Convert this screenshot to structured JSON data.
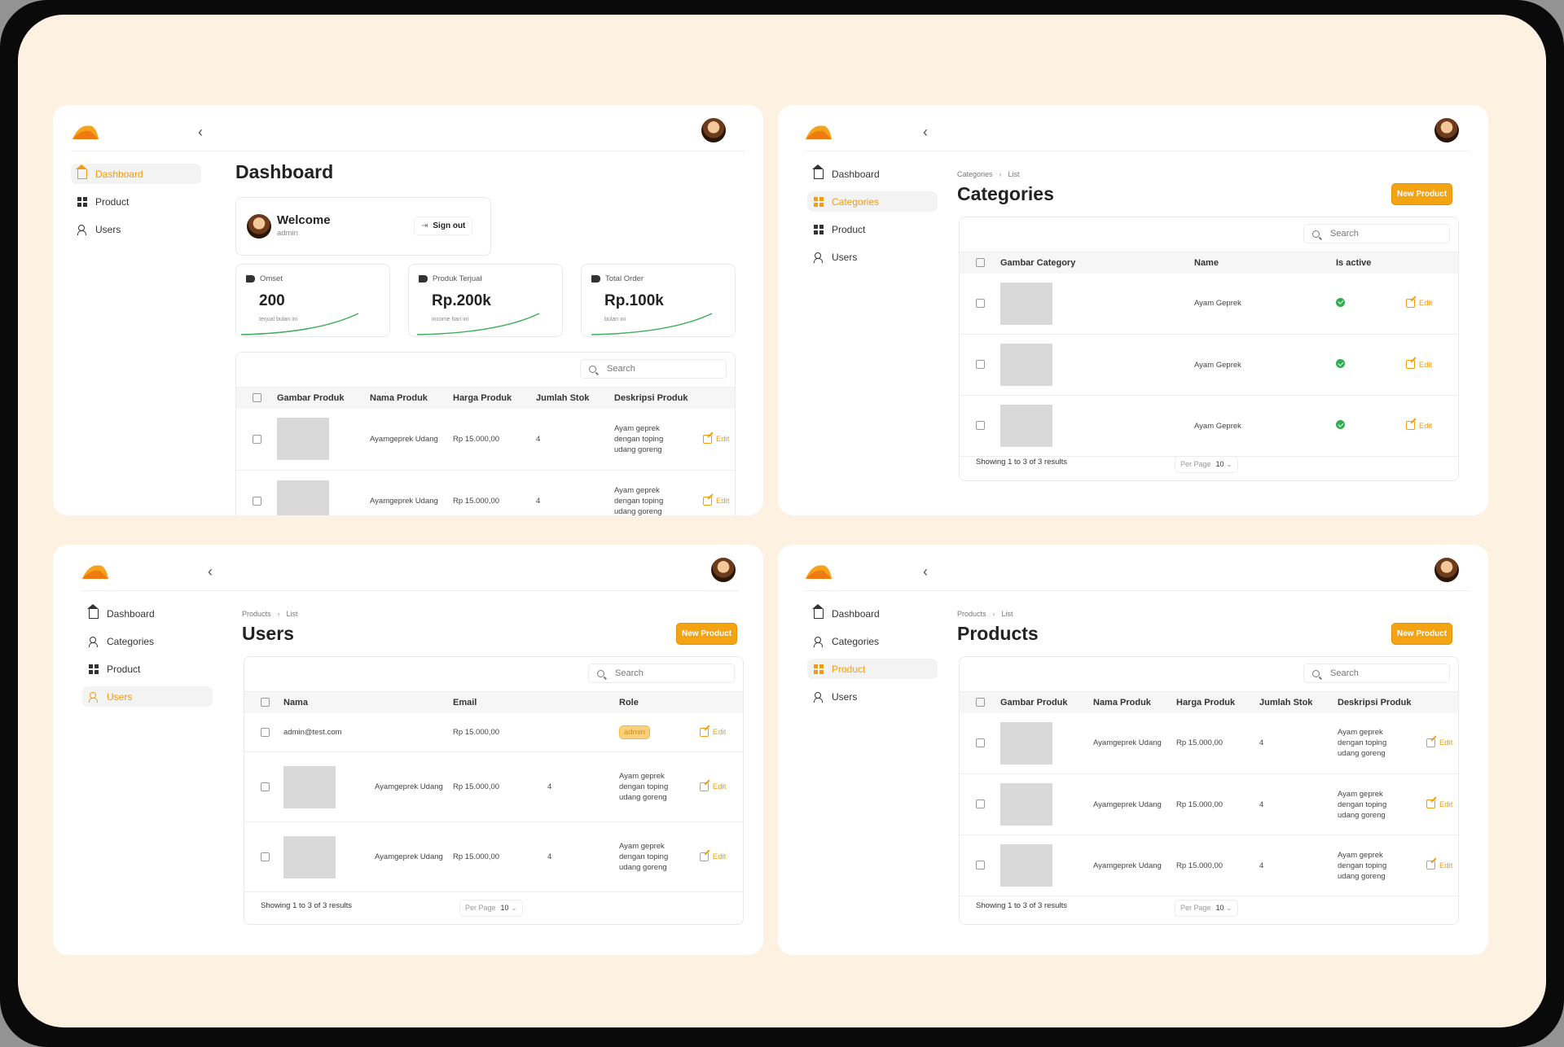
{
  "colors": {
    "accent": "#f29c11",
    "button": "#f4a312",
    "active_check": "#2eae4f",
    "canvas": "#fdf1e2"
  },
  "icons": {
    "logo": "orange-fan-logo",
    "collapse": "chevron-left-icon",
    "avatar": "user-avatar"
  },
  "dashboard": {
    "sidebar": [
      {
        "label": "Dashboard",
        "icon": "home-icon",
        "active": true
      },
      {
        "label": "Product",
        "icon": "grid-icon"
      },
      {
        "label": "Users",
        "icon": "users-icon"
      }
    ],
    "title": "Dashboard",
    "welcome": {
      "title": "Welcome",
      "role": "admin",
      "signout": "Sign out"
    },
    "stats": [
      {
        "label": "Omset",
        "value": "200",
        "sub": "terjual bulan ini",
        "icon": "tag-icon"
      },
      {
        "label": "Produk Terjual",
        "value": "Rp.200k",
        "sub": "income hari ini",
        "icon": "tag-icon"
      },
      {
        "label": "Total Order",
        "value": "Rp.100k",
        "sub": "bulan ini",
        "icon": "tag-icon"
      }
    ],
    "search_placeholder": "Search",
    "columns": [
      "Gambar Produk",
      "Nama Produk",
      "Harga Produk",
      "Jumlah Stok",
      "Deskripsi Produk"
    ],
    "rows": [
      {
        "name": "Ayamgeprek Udang",
        "price": "Rp 15.000,00",
        "stock": "4",
        "desc": [
          "Ayam geprek",
          "dengan toping",
          "udang goreng"
        ],
        "edit": "Edit"
      },
      {
        "name": "Ayamgeprek Udang",
        "price": "Rp 15.000,00",
        "stock": "4",
        "desc": [
          "Ayam geprek",
          "dengan toping",
          "udang goreng"
        ],
        "edit": "Edit"
      }
    ]
  },
  "categories": {
    "sidebar": [
      {
        "label": "Dashboard",
        "icon": "home-icon"
      },
      {
        "label": "Categories",
        "icon": "grid-icon",
        "active": true
      },
      {
        "label": "Product",
        "icon": "grid-icon"
      },
      {
        "label": "Users",
        "icon": "users-icon"
      }
    ],
    "breadcrumb": [
      "Categories",
      "List"
    ],
    "title": "Categories",
    "new_button": "New Product",
    "search_placeholder": "Search",
    "columns": [
      "Gambar Category",
      "Name",
      "Is active"
    ],
    "rows": [
      {
        "name": "Ayam Geprek",
        "active": true,
        "edit": "Edit"
      },
      {
        "name": "Ayam Geprek",
        "active": true,
        "edit": "Edit"
      },
      {
        "name": "Ayam Geprek",
        "active": true,
        "edit": "Edit"
      }
    ],
    "footer": "Showing 1 to 3 of 3 results",
    "per_page_label": "Per Page",
    "per_page_value": "10"
  },
  "users": {
    "sidebar": [
      {
        "label": "Dashboard",
        "icon": "home-icon"
      },
      {
        "label": "Categories",
        "icon": "users-icon"
      },
      {
        "label": "Product",
        "icon": "grid-icon"
      },
      {
        "label": "Users",
        "icon": "users-icon",
        "active": true
      }
    ],
    "breadcrumb": [
      "Products",
      "List"
    ],
    "title": "Users",
    "new_button": "New Product",
    "search_placeholder": "Search",
    "columns": [
      "Nama",
      "Email",
      "Role"
    ],
    "user_row": {
      "name": "admin@test.com",
      "email": "Rp 15.000,00",
      "role": "admin",
      "edit": "Edit"
    },
    "rows": [
      {
        "name": "Ayamgeprek Udang",
        "price": "Rp 15.000,00",
        "stock": "4",
        "desc": [
          "Ayam geprek",
          "dengan toping",
          "udang goreng"
        ],
        "edit": "Edit"
      },
      {
        "name": "Ayamgeprek Udang",
        "price": "Rp 15.000,00",
        "stock": "4",
        "desc": [
          "Ayam geprek",
          "dengan toping",
          "udang goreng"
        ],
        "edit": "Edit"
      }
    ],
    "footer": "Showing 1 to 3 of 3 results",
    "per_page_label": "Per Page",
    "per_page_value": "10"
  },
  "products": {
    "sidebar": [
      {
        "label": "Dashboard",
        "icon": "home-icon"
      },
      {
        "label": "Categories",
        "icon": "users-icon"
      },
      {
        "label": "Product",
        "icon": "grid-icon",
        "active": true
      },
      {
        "label": "Users",
        "icon": "users-icon"
      }
    ],
    "breadcrumb": [
      "Products",
      "List"
    ],
    "title": "Products",
    "new_button": "New Product",
    "search_placeholder": "Search",
    "columns": [
      "Gambar Produk",
      "Nama Produk",
      "Harga Produk",
      "Jumlah Stok",
      "Deskripsi Produk"
    ],
    "rows": [
      {
        "name": "Ayamgeprek Udang",
        "price": "Rp 15.000,00",
        "stock": "4",
        "desc": [
          "Ayam geprek",
          "dengan toping",
          "udang goreng"
        ],
        "edit": "Edit"
      },
      {
        "name": "Ayamgeprek Udang",
        "price": "Rp 15.000,00",
        "stock": "4",
        "desc": [
          "Ayam geprek",
          "dengan toping",
          "udang goreng"
        ],
        "edit": "Edit"
      },
      {
        "name": "Ayamgeprek Udang",
        "price": "Rp 15.000,00",
        "stock": "4",
        "desc": [
          "Ayam geprek",
          "dengan toping",
          "udang goreng"
        ],
        "edit": "Edit"
      }
    ],
    "footer": "Showing 1 to 3 of 3 results",
    "per_page_label": "Per Page",
    "per_page_value": "10"
  }
}
